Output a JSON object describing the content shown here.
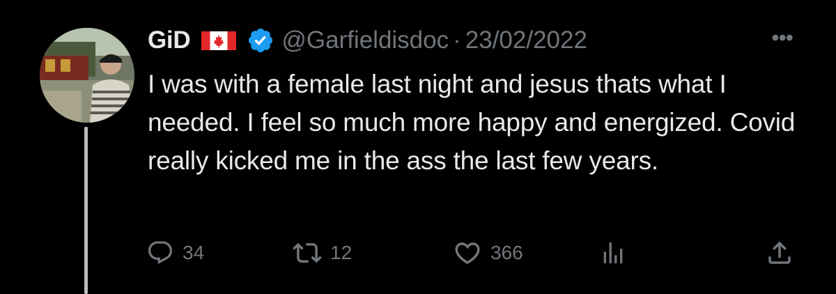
{
  "tweet": {
    "display_name": "GiD",
    "flag_icon": "canada-flag-icon",
    "verified_icon": "verified-badge-icon",
    "handle": "@Garfieldisdoc",
    "separator": "·",
    "date": "23/02/2022",
    "more_icon": "more-options-icon",
    "more_label": "•••",
    "text": "I was with a female last night and jesus thats what I needed. I feel so much more happy and energized. Covid really kicked me in the ass the last few years."
  },
  "actions": {
    "replies": "34",
    "retweets": "12",
    "likes": "366"
  },
  "colors": {
    "background": "#000000",
    "primary_text": "#e7e9ea",
    "secondary_text": "#71767b",
    "verified_blue": "#1d9bf0",
    "thread_line": "#b9bcc0"
  }
}
